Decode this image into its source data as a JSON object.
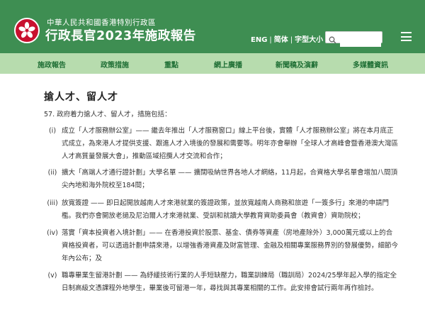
{
  "header": {
    "gov_name": "中華人民共和國香港特別行政區",
    "title": "行政長官2023年施政報告",
    "lang_eng": "ENG",
    "lang_simplified": "简体",
    "font_size": "字型大小",
    "search_placeholder": ""
  },
  "nav": {
    "items": [
      "施政報告",
      "政策措施",
      "重點",
      "網上廣播",
      "新聞稿及演辭",
      "多媒體資訊"
    ]
  },
  "main": {
    "section_title": "搶人才、留人才",
    "intro": "57. 政府着力搶人才、留人才，措施包括：",
    "items": [
      {
        "num": "(i)",
        "text": "成立「人才服務辦公室」—— 繼去年推出「人才服務窗口」線上平台後，實體「人才服務辦公室」將在本月底正式成立，為來港人才提供支援、跟進人才入境後的發展和需要等。明年亦會舉辦「全球人才高峰會暨香港澳大灣區人才高質量發展大會」，推動區域招攬人才交流和合作；"
      },
      {
        "num": "(ii)",
        "text": "擴大「高端人才通行證計劃」大學名單 —— 擴闊吸納世界各地人才網絡，11月起，合資格大學名單會增加八間頂尖內地和海外院校至184間；"
      },
      {
        "num": "(iii)",
        "text": "放寬簽證 —— 即日起開放越南人才來港就業的簽證政策，並放寬越南人商務和旅遊「一簽多行」來港的申請門檻。我們亦會開放老撾及尼泊爾人才來港就業、受訓和就讀大學教育資助委員會（教資會）資助院校；"
      },
      {
        "num": "(iv)",
        "text": "落實「資本投資者入境計劃」—— 在香港投資於股票、基金、債券等資產（房地產除外）3,000萬元或以上的合資格投資者，可以透過計劃申請來港，以增強香港資產及財富管理、金融及相關專業服務界別的發展優勢，細節今年內公布；及"
      },
      {
        "num": "(v)",
        "text": "職專畢業生留港計劃 —— 為紓緩技術行業的人手短缺壓力，職業訓練局（職訓局）2024/25學年起入學的指定全日制高級文憑課程外地學生，畢業後可留港一年，尋找與其專業相關的工作。此安排會試行兩年再作檢討。"
      }
    ]
  },
  "colors": {
    "header_green": "#3e8e52",
    "nav_green": "#b7dcae",
    "nav_text": "#1f6f35",
    "emblem_red": "#c8102e"
  }
}
